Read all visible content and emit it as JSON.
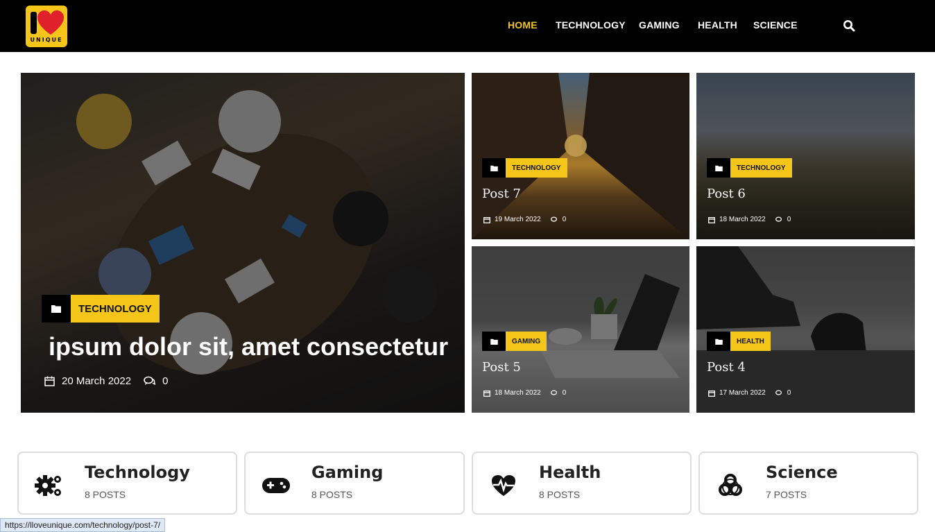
{
  "logo": {
    "word": "UNIQUE",
    "brand_color": "#f5c518",
    "heart_color": "#e0202a"
  },
  "nav": {
    "items": [
      {
        "label": "HOME",
        "active": true
      },
      {
        "label": "TECHNOLOGY"
      },
      {
        "label": "GAMING"
      },
      {
        "label": "HEALTH"
      },
      {
        "label": "SCIENCE"
      }
    ],
    "search_icon": "search-icon"
  },
  "featured": {
    "category": "TECHNOLOGY",
    "title": "ipsum dolor sit, amet consectetur",
    "date": "20 March 2022",
    "comments": "0"
  },
  "posts": [
    {
      "category": "TECHNOLOGY",
      "title": "Post 7",
      "date": "19 March 2022",
      "comments": "0"
    },
    {
      "category": "TECHNOLOGY",
      "title": "Post 6",
      "date": "18 March 2022",
      "comments": "0"
    },
    {
      "category": "GAMING",
      "title": "Post 5",
      "date": "18 March 2022",
      "comments": "0"
    },
    {
      "category": "HEALTH",
      "title": "Post 4",
      "date": "17 March 2022",
      "comments": "0"
    }
  ],
  "categories": [
    {
      "name": "Technology",
      "count": "8 POSTS",
      "icon": "gears-icon"
    },
    {
      "name": "Gaming",
      "count": "8 POSTS",
      "icon": "gamepad-icon"
    },
    {
      "name": "Health",
      "count": "8 POSTS",
      "icon": "heartbeat-icon"
    },
    {
      "name": "Science",
      "count": "7 POSTS",
      "icon": "biohazard-icon"
    }
  ],
  "status_bar": {
    "url": "https://lloveunique.com/technology/post-7/"
  }
}
